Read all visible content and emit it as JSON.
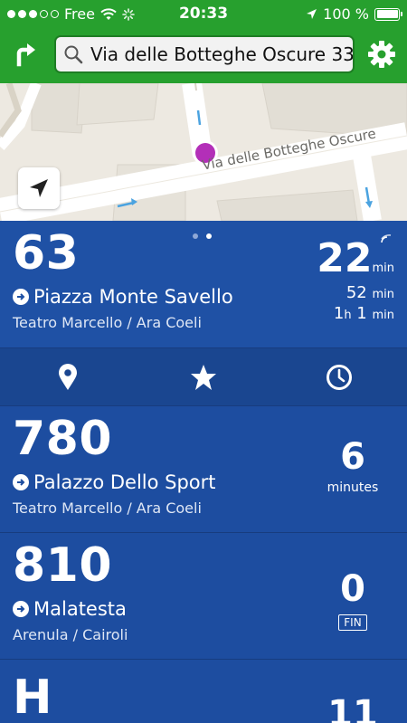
{
  "status_bar": {
    "carrier": "Free",
    "time": "20:33",
    "battery": "100 %"
  },
  "header": {
    "search_value": "Via delle Botteghe Oscure 33"
  },
  "map": {
    "street_label": "Via delle Botteghe Oscure"
  },
  "colors": {
    "header_green": "#27a02e",
    "card_blue": "#1f51a5",
    "pin_magenta": "#b32fb8"
  },
  "routes": [
    {
      "line": "63",
      "destination": "Piazza Monte Savello",
      "stop": "Teatro Marcello / Ara Coeli",
      "arrivals": [
        {
          "value": "22",
          "unit": "min"
        },
        {
          "value": "52",
          "unit": "min"
        },
        {
          "value_h": "1",
          "unit_h": "h",
          "value_m": "1",
          "unit_m": "min"
        }
      ]
    },
    {
      "line": "780",
      "destination": "Palazzo Dello Sport",
      "stop": "Teatro Marcello / Ara Coeli",
      "time": "6",
      "unit": "minutes"
    },
    {
      "line": "810",
      "destination": "Malatesta",
      "stop": "Arenula / Cairoli",
      "time": "0",
      "badge": "FIN"
    },
    {
      "line": "H",
      "time": "11"
    }
  ],
  "icons": [
    "turn-right-icon",
    "search-icon",
    "gear-icon",
    "locate-arrow-icon",
    "pin-icon",
    "star-icon",
    "clock-icon",
    "arrow-right-circle-icon",
    "wifi-icon",
    "realtime-signal-icon"
  ]
}
